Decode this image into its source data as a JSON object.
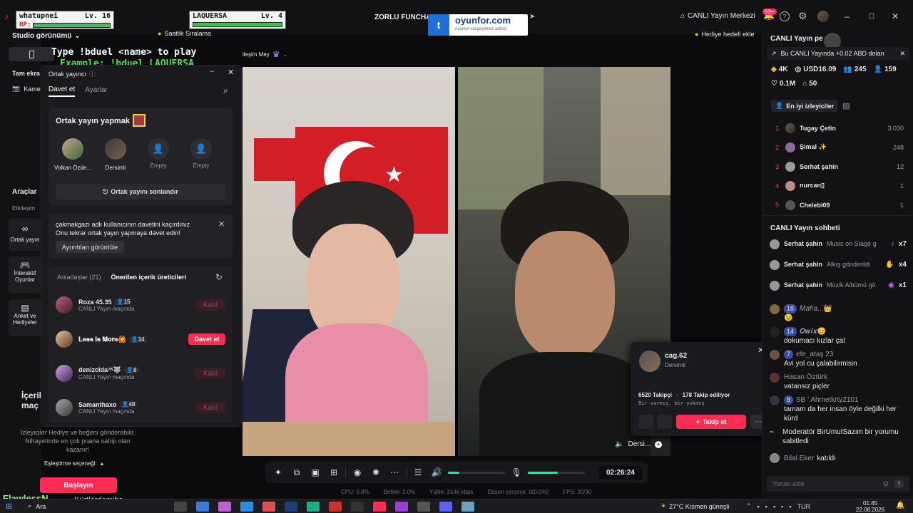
{
  "overlay": {
    "player1": {
      "name": "whatupnei",
      "level": "Lv. 16",
      "hp_label": "HP:"
    },
    "player2": {
      "name": "LAQUERSA",
      "level": "Lv. 4"
    },
    "duel_line1": "Type !bduel <name> to play",
    "duel_line2": "Example: !bduel LAQUERSA",
    "sponsor": {
      "text": "oyunfor.com",
      "sub": "oyunun vazgeçilmez adresi"
    },
    "hourly_rank": "Saatlik Sıralama",
    "goal": "Hediye hedefi ekle",
    "event_title": "ZORLU FUNCHAL",
    "center_frag": "ileşim Mey"
  },
  "topbar": {
    "live_center": "CANLI Yayın Merkezi",
    "notif_count": "99+",
    "window_min": "–",
    "window_max": "□",
    "window_close": "✕"
  },
  "leftrail": {
    "studio_view": "Studio görünümü",
    "fullscreen": "Tam ekra",
    "camera": "Kame",
    "tools": "Araçlar",
    "interaction": "Etkileşim",
    "cohost": "Ortak yayın",
    "interactive_games": "İnteraktif Oyunlar",
    "poll_gifts": "Anket ve Hediyeler",
    "content_heading": "İçerik maç",
    "content_desc": "İzleyiciler Hediye ve beğeni gönderebilir. Nihayetinde en çok puana sahip olan kazanır!",
    "match_option": "Eşleştirme seçeneği:",
    "start_button": "Başlayın"
  },
  "cohost": {
    "title": "Ortak yayıncı",
    "tabs": [
      "Davet et",
      "Ayarlar"
    ],
    "section_title": "Ortak yayın yapmak",
    "slots": [
      {
        "name": "Volkan Özde..."
      },
      {
        "name": "Dersimli"
      },
      {
        "name": "Empty"
      },
      {
        "name": "Empty"
      }
    ],
    "end_button": "Ortak yayını sonlandır",
    "notice_line1": "çakmakgazı adlı kullanıcının davetini kaçırdınız",
    "notice_line2": "Onu tekrar ortak yayın yapmaya davet edin!",
    "notice_button": "Ayrıntıları görüntüle",
    "friends_tab": "Arkadaşlar (21)",
    "creators_tab": "Önerilen içerik üreticileri",
    "friends": [
      {
        "name": "Roza 45.35",
        "count": "15",
        "status": "CANLI Yayın maçında",
        "action": "Katıl"
      },
      {
        "name": "𝐋𝐞𝐬𝐬 𝐢𝐬 𝐌𝐨𝐫𝐞🙆",
        "count": "34",
        "status": "",
        "action": "Davet et"
      },
      {
        "name": "denizclda⁷ᴷ🐺",
        "count": "8",
        "status": "CANLI Yayın maçında",
        "action": "Katıl"
      },
      {
        "name": "Samanthaxo",
        "count": "48",
        "status": "CANLI Yayın maçında",
        "action": "Katıl"
      }
    ]
  },
  "profile_card": {
    "handle": "cag.62",
    "name": "Dersimli",
    "followers": "6520 Takipçi",
    "following": "178 Takip ediliyor",
    "bio": "Bir varmış, bir yokmuş",
    "follow_button": "Takip et"
  },
  "video_overlay": {
    "label": "Dersi...",
    "timer": "02:26:24"
  },
  "stats": {
    "cpu": "CPU: 9.9%",
    "memory": "Bellek: 2.0%",
    "upload": "Yükle: 3146 kbps",
    "dropped": "Düşen çerçeve: 0(0.0%)",
    "fps": "FPS: 30/30"
  },
  "rightpanel": {
    "title": "CANLI Yayın pe",
    "promo": "Bu CANLI Yayında +0.02 ABD doları",
    "metrics": [
      {
        "icon": "coin-icon",
        "value": "4K"
      },
      {
        "icon": "dollar-icon",
        "value": "USD16.09"
      },
      {
        "icon": "viewers-icon",
        "value": "245"
      },
      {
        "icon": "followers-icon",
        "value": "159"
      },
      {
        "icon": "heart-icon",
        "value": "0.1M"
      },
      {
        "icon": "gift-icon",
        "value": "50"
      }
    ],
    "top_viewers_label": "En iyi izleyiciler",
    "top_viewers": [
      {
        "rank": "1",
        "name": "Tugay Çetin",
        "score": "3.030"
      },
      {
        "rank": "2",
        "name": "Şimal ✨",
        "score": "248"
      },
      {
        "rank": "3",
        "name": "Serhat şahin",
        "score": "12"
      },
      {
        "rank": "4",
        "name": "nurcan▯",
        "score": "1"
      },
      {
        "rank": "5",
        "name": "Chelebi09",
        "score": "1"
      }
    ],
    "chat_title": "CANLI Yayın sohbeti",
    "gifts": [
      {
        "user": "Serhat şahin",
        "text": "Music on Stage g",
        "count": "x7"
      },
      {
        "user": "Serhat şahin",
        "text": "Alkış gönderildi",
        "count": "x4"
      },
      {
        "user": "Serhat şahin",
        "text": "Müzik Albümü gö",
        "count": "x1"
      }
    ],
    "chat": [
      {
        "badge": "18",
        "user": "𝑀𝑎𝑓𝑖𝑎...👑",
        "msg": "😉"
      },
      {
        "badge": "14",
        "user": "𝑶𝒘𝒊𝒙😊",
        "msg": "dokumacı kızlar çal"
      },
      {
        "badge": "7",
        "user": "efe_ataş 23",
        "msg": "Avi yol cu çalabilirmisin"
      },
      {
        "badge": "",
        "user": "Hasan Öztürk",
        "msg": "vatansız piçler"
      },
      {
        "badge": "8",
        "user": "SB ' Ahmetkrty2101",
        "msg": "tamam da her insan öyle değilki her kürd"
      },
      {
        "badge": "",
        "user": "Moderatör",
        "msg": "BirUmutSazım bir yorumu sabitledi"
      },
      {
        "badge": "",
        "user": "Bilal Eker",
        "msg": "katıldı"
      }
    ],
    "comment_placeholder": "Yorum ekle"
  },
  "taskbar": {
    "search": "Ara",
    "stream_overlay": "FlawlessN...",
    "stream_overlay2": "Kürtlerdemibe",
    "weather": "27°C  Kısmen güneşli",
    "lang": "TUR",
    "time": "01:45",
    "date": "22.08.2026"
  },
  "colors": {
    "accent": "#fe2c55",
    "panel": "#1a1a1e",
    "bg": "#0b0b0d"
  }
}
